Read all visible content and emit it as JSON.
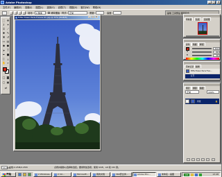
{
  "app": {
    "title": "Adobe Photoshop",
    "icon": "photoshop-app-icon"
  },
  "window_buttons": {
    "minimize": "_",
    "maximize": "□",
    "close": "×"
  },
  "menu": [
    "文件(F)",
    "编辑(E)",
    "图像(I)",
    "图层(L)",
    "选择(S)",
    "滤镜(T)",
    "视图(V)",
    "窗口(W)",
    "帮助(H)"
  ],
  "options": {
    "feather_label": "羽化:",
    "feather_value": "0 像素",
    "antialias_label": "消除锯齿",
    "style_label": "样式:",
    "style_value": "正常",
    "width_label": "宽度:",
    "height_label": "高度:",
    "brush_well": "画笔 工具预设 图层复合"
  },
  "document": {
    "title": "Eiffel Tower Paris France 01.jpg @ 33% (RGB/8)",
    "min": "_",
    "max": "□",
    "close": "×"
  },
  "colors": {
    "foreground": "#d42a1a",
    "background": "#ffffff",
    "canvas_bg": "#7a7a7a",
    "accent": "#0a246a"
  },
  "tools": [
    "marquee",
    "move",
    "lasso",
    "magic-wand",
    "crop",
    "slice",
    "healing",
    "brush",
    "stamp",
    "history-brush",
    "eraser",
    "gradient",
    "blur",
    "dodge",
    "path-select",
    "type",
    "pen",
    "shape",
    "notes",
    "eyedropper",
    "hand",
    "zoom"
  ],
  "palettes": {
    "navigator": {
      "tabs": [
        "导航器",
        "信息",
        "直方图"
      ]
    },
    "color": {
      "tabs": [
        "颜色",
        "色板",
        "样式"
      ],
      "channels": [
        {
          "label": "R",
          "value": "212"
        },
        {
          "label": "G",
          "value": "42"
        },
        {
          "label": "B",
          "value": "26"
        }
      ]
    },
    "history": {
      "tabs": [
        "历史记录",
        "动作"
      ],
      "entries": [
        "Eiffel Tower Paris Fran...",
        "打开"
      ]
    },
    "layers": {
      "tabs": [
        "图层",
        "通道",
        "路径"
      ],
      "blend": "正常",
      "opacity": "100%",
      "layer_name": "背景"
    }
  },
  "status": {
    "zoom": "33.33%",
    "doc_info": "文档:2.25M/2.25M",
    "hint": "点按并拖移以选择新选区。要用附加选项，使用 Shift、Alt 和 Ctrl 键。"
  },
  "taskbar": {
    "start": "开始",
    "tasks": [
      "2 Windows...",
      "2 Int...",
      "Microsoft...",
      "我的文档",
      "360安全浏...",
      "Adobe Pho...",
      "未命名 - 画图"
    ],
    "active_task": 5,
    "lang": "CH",
    "clock": "13:48"
  }
}
